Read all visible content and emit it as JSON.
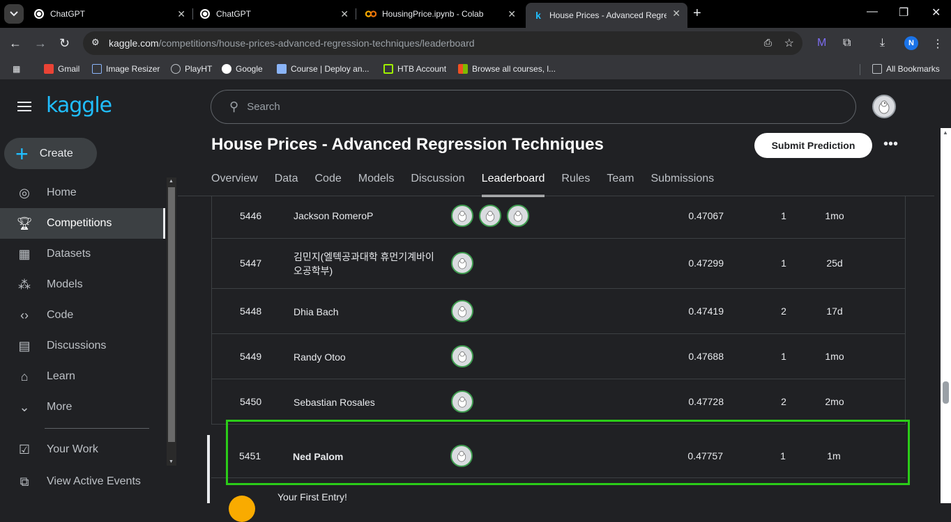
{
  "browser": {
    "tabs": [
      {
        "title": "ChatGPT",
        "icon": "chatgpt-icon"
      },
      {
        "title": "ChatGPT",
        "icon": "chatgpt-icon"
      },
      {
        "title": "HousingPrice.ipynb - Colab",
        "icon": "colab-icon"
      },
      {
        "title": "House Prices - Advanced Regre",
        "icon": "kaggle-icon"
      }
    ],
    "url_host": "kaggle.com",
    "url_path": "/competitions/house-prices-advanced-regression-techniques/leaderboard",
    "profile_initial": "N",
    "bookmarks": [
      "Gmail",
      "Image Resizer",
      "PlayHT",
      "Google",
      "Course | Deploy an...",
      "HTB Account",
      "Browse all courses, l...",
      "All Bookmarks"
    ]
  },
  "kaggle": {
    "create_label": "Create",
    "nav": [
      "Home",
      "Competitions",
      "Datasets",
      "Models",
      "Code",
      "Discussions",
      "Learn",
      "More",
      "Your Work",
      "View Active Events"
    ],
    "search_placeholder": "Search",
    "competition_title": "House Prices - Advanced Regression Techniques",
    "submit_label": "Submit Prediction",
    "tabs": [
      "Overview",
      "Data",
      "Code",
      "Models",
      "Discussion",
      "Leaderboard",
      "Rules",
      "Team",
      "Submissions"
    ],
    "active_tab": "Leaderboard"
  },
  "leaderboard": [
    {
      "rank": "5446",
      "team": "Jackson RomeroP",
      "members": 3,
      "score": "0.47067",
      "entries": "1",
      "last": "1mo"
    },
    {
      "rank": "5447",
      "team": "김민지(엘텍공과대학 휴먼기계바이오공학부)",
      "members": 1,
      "score": "0.47299",
      "entries": "1",
      "last": "25d"
    },
    {
      "rank": "5448",
      "team": "Dhia Bach",
      "members": 1,
      "score": "0.47419",
      "entries": "2",
      "last": "17d"
    },
    {
      "rank": "5449",
      "team": "Randy Otoo",
      "members": 1,
      "score": "0.47688",
      "entries": "1",
      "last": "1mo"
    },
    {
      "rank": "5450",
      "team": "Sebastian Rosales",
      "members": 1,
      "score": "0.47728",
      "entries": "2",
      "last": "2mo"
    },
    {
      "rank": "5451",
      "team": "Ned Palom",
      "members": 1,
      "score": "0.47757",
      "entries": "1",
      "last": "1m"
    }
  ],
  "first_entry_text": "Your First Entry!",
  "colors": {
    "kaggle_blue": "#20beff",
    "highlight_green": "#2bcc18"
  }
}
